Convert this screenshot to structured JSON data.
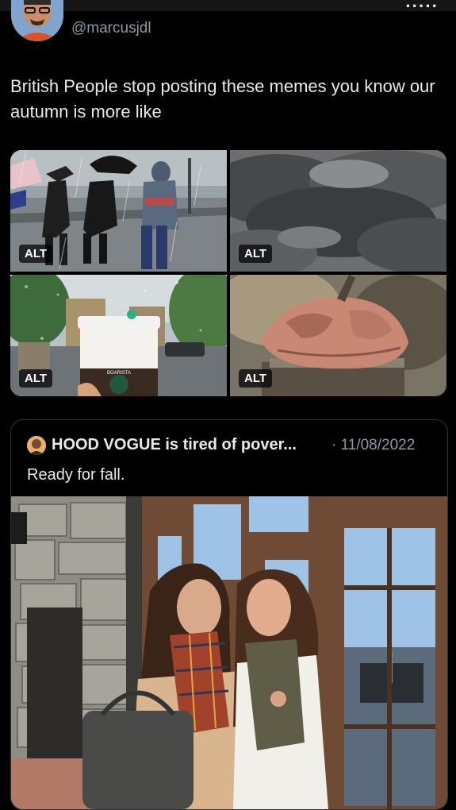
{
  "tweet": {
    "handle": "@marcusjdl",
    "text": "British People stop posting these memes you know our autumn is more like",
    "media": [
      {
        "alt_label": "ALT",
        "description": "people-in-rain-with-umbrellas"
      },
      {
        "alt_label": "ALT",
        "description": "stormy-clouds"
      },
      {
        "alt_label": "ALT",
        "description": "coffee-cup-rainy-window"
      },
      {
        "alt_label": "ALT",
        "description": "rotting-pumpkin"
      }
    ],
    "cup_text": "BOARISTA"
  },
  "quote": {
    "display_name": "HOOD VOGUE is tired of pover...",
    "date": "11/08/2022",
    "text": "Ready for fall."
  },
  "colors": {
    "background": "#000000",
    "text_primary": "#e7e9ea",
    "text_secondary": "#8b98a5",
    "border": "#2f3336",
    "verified_blue": "#1d9bf0"
  }
}
